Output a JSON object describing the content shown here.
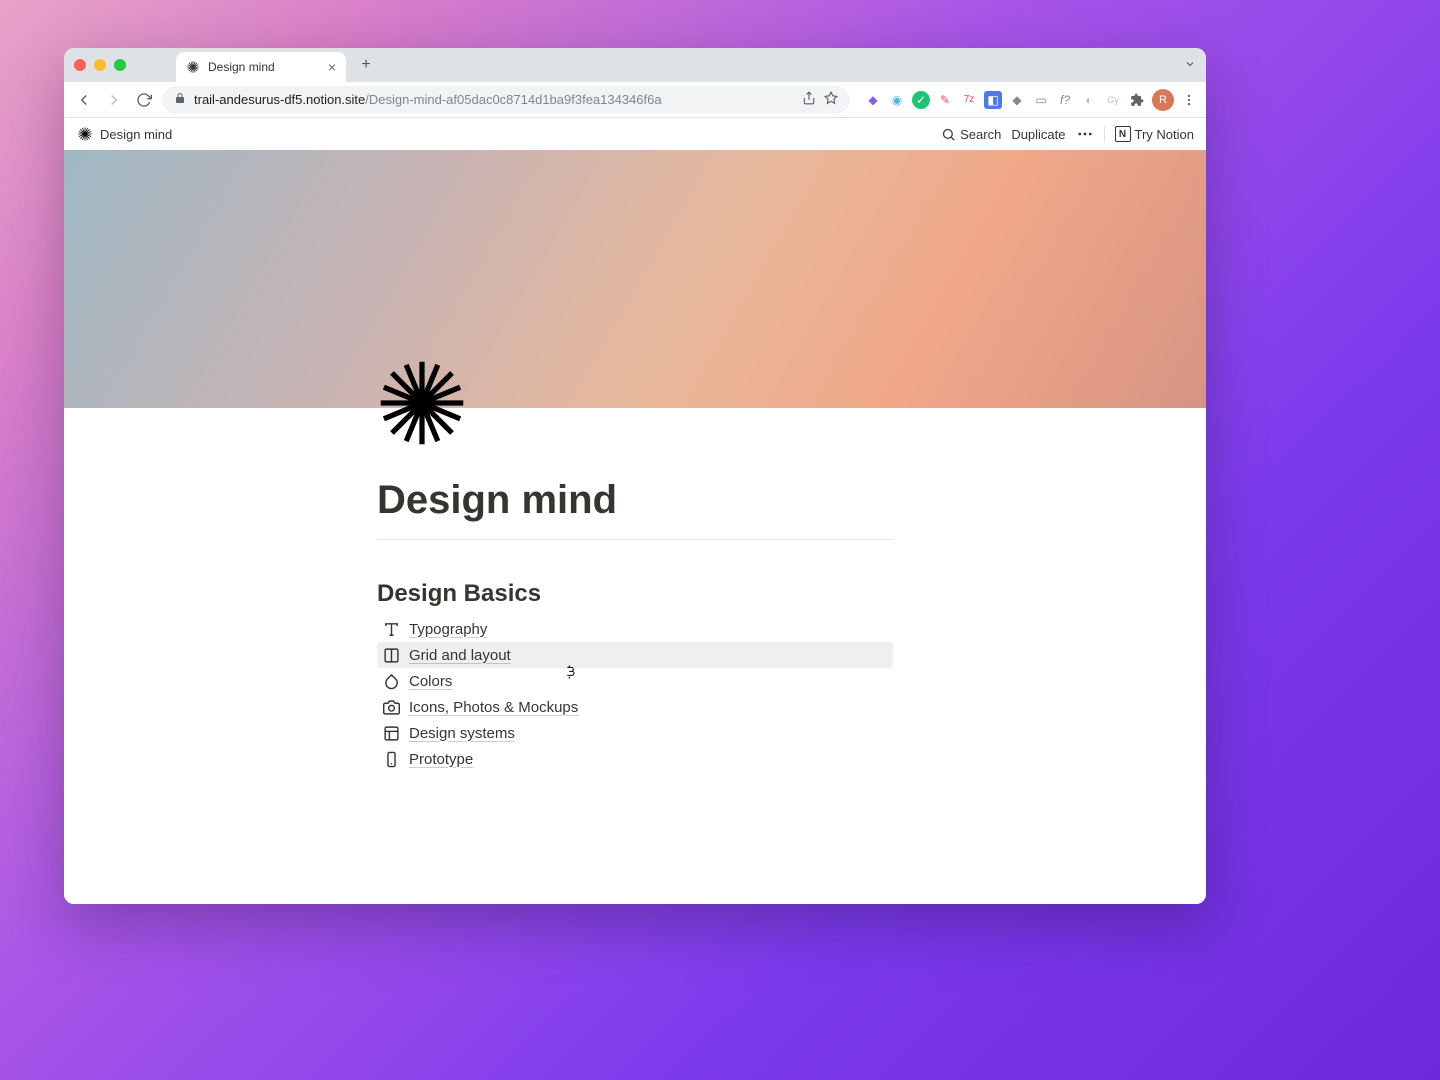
{
  "browser": {
    "tab_title": "Design mind",
    "url_domain": "trail-andesurus-df5.notion.site",
    "url_path": "/Design-mind-af05dac0c8714d1ba9f3fea134346f6a",
    "avatar_initial": "R"
  },
  "notion_bar": {
    "breadcrumb": "Design mind",
    "search": "Search",
    "duplicate": "Duplicate",
    "try_notion": "Try Notion"
  },
  "page": {
    "title": "Design mind",
    "section_heading": "Design Basics",
    "links": [
      {
        "label": "Typography",
        "icon": "text-t"
      },
      {
        "label": "Grid and layout",
        "icon": "columns"
      },
      {
        "label": "Colors",
        "icon": "droplet"
      },
      {
        "label": "Icons, Photos & Mockups",
        "icon": "camera"
      },
      {
        "label": "Design systems",
        "icon": "layout"
      },
      {
        "label": "Prototype",
        "icon": "phone"
      }
    ]
  },
  "hovered_index": 1
}
